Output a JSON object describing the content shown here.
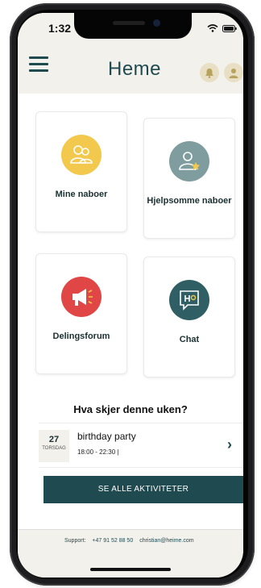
{
  "status": {
    "time": "1:32"
  },
  "header": {
    "logo": "Heme"
  },
  "tiles": [
    {
      "label": "Mine naboer",
      "color": "#f2c94c",
      "icon": "people-icon"
    },
    {
      "label": "Hjelpsomme naboer",
      "color": "#7f9c9f",
      "icon": "person-star-icon"
    },
    {
      "label": "Delingsforum",
      "color": "#e04646",
      "icon": "megaphone-icon"
    },
    {
      "label": "Chat",
      "color": "#2f5f64",
      "icon": "chat-icon"
    }
  ],
  "section": {
    "title": "Hva skjer denne uken?"
  },
  "activity": {
    "day": "27",
    "weekday": "TORSDAG",
    "title": "birthday party",
    "time": "18:00 - 22:30 |"
  },
  "cta": {
    "label": "SE ALLE AKTIVITETER"
  },
  "footer": {
    "support_label": "Support:",
    "phone": "+47 91 52 88 50",
    "email": "christian@heime.com"
  },
  "colors": {
    "primary": "#1f4a4f",
    "background": "#f3f1ec"
  }
}
